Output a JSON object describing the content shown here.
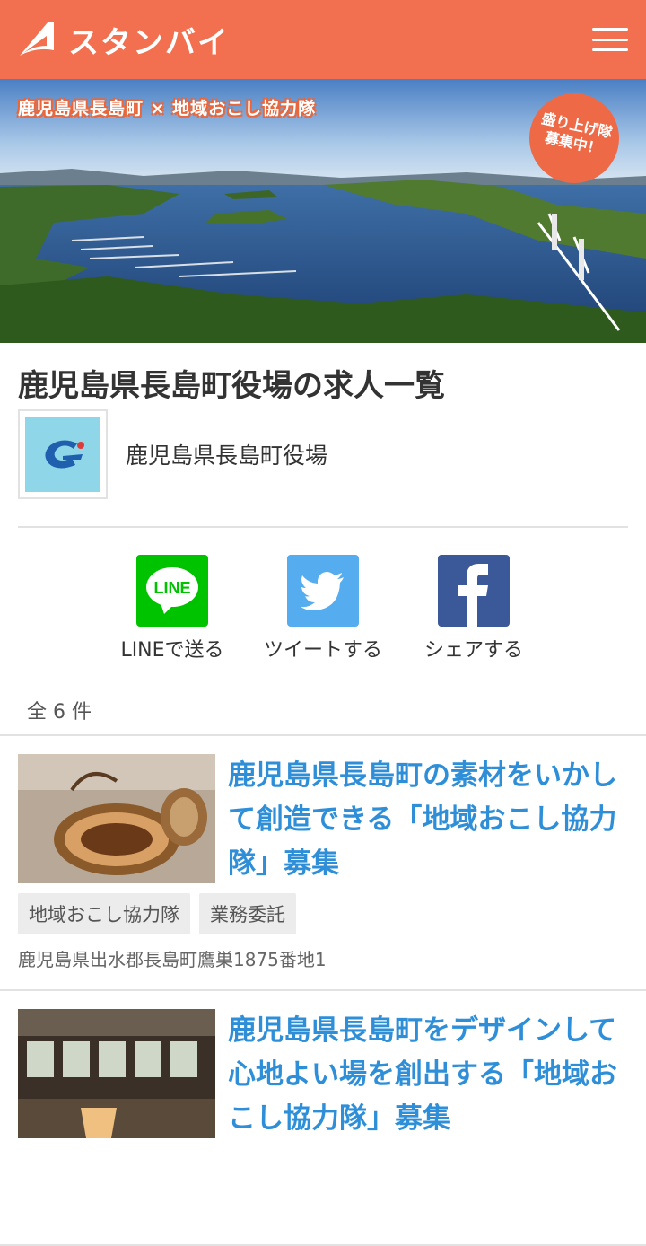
{
  "header": {
    "brand": "スタンバイ",
    "menu_icon": "hamburger-menu-icon"
  },
  "hero": {
    "caption": "鹿児島県長島町 × 地域おこし協力隊",
    "badge_line1": "盛り上げ隊",
    "badge_line2": "募集中！"
  },
  "page_title": "鹿児島県長島町役場の求人一覧",
  "company": {
    "name": "鹿児島県長島町役場"
  },
  "share": [
    {
      "label": "LINEで送る",
      "icon": "line-icon",
      "icon_text": "LINE",
      "color": "#00c300"
    },
    {
      "label": "ツイートする",
      "icon": "twitter-icon",
      "color": "#55acee"
    },
    {
      "label": "シェアする",
      "icon": "facebook-icon",
      "color": "#3b5998"
    }
  ],
  "count": "全 6 件",
  "jobs": [
    {
      "title": "鹿児島県長島町の素材をいかして創造できる「地域おこし協力隊」募集",
      "tags": [
        "地域おこし協力隊",
        "業務委託"
      ],
      "address": "鹿児島県出水郡長島町鷹巣1875番地1"
    },
    {
      "title": "鹿児島県長島町をデザインして心地よい場を創出する「地域おこし協力隊」募集"
    }
  ]
}
